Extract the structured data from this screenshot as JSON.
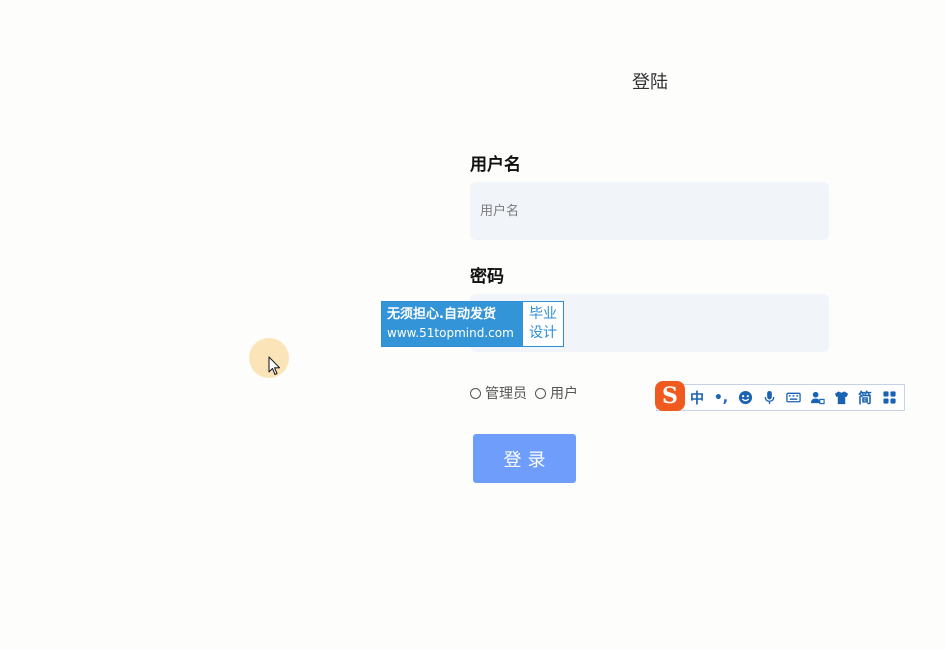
{
  "login": {
    "title": "登陆",
    "username_label": "用户名",
    "username_placeholder": "用户名",
    "username_value": "",
    "password_label": "密码",
    "password_placeholder": "",
    "password_value": "",
    "roles": [
      {
        "label": "管理员",
        "selected": false
      },
      {
        "label": "用户",
        "selected": false
      }
    ],
    "submit_label": "登录"
  },
  "watermark": {
    "line1": "无须担心.自动发货",
    "line2": "www.51topmind.com",
    "right_line1": "毕业",
    "right_line2": "设计"
  },
  "ime_toolbar": {
    "logo_glyph": "S",
    "mode_label": "中",
    "punct_label": "•,",
    "simplified_label": "简",
    "icons": [
      "sogou-logo-icon",
      "chinese-mode-icon",
      "punctuation-icon",
      "emoji-icon",
      "microphone-icon",
      "keyboard-icon",
      "user-account-icon",
      "skin-shirt-icon",
      "simplified-icon",
      "toolbox-grid-icon"
    ]
  },
  "colors": {
    "primary_button": "#6e9dfb",
    "input_bg": "#f1f4f8",
    "watermark_blue": "#3494d8",
    "ime_blue": "#1a63b3",
    "ime_logo": "#f05a1e",
    "cursor_halo": "#fae4b8"
  }
}
